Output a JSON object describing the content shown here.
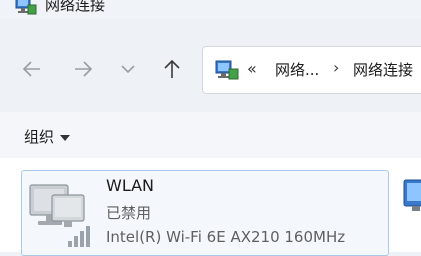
{
  "window": {
    "title": "网络连接"
  },
  "nav": {
    "back_icon": "arrow-left-icon",
    "forward_icon": "arrow-right-icon",
    "recent_icon": "chevron-down-icon",
    "up_icon": "arrow-up-icon"
  },
  "address": {
    "overflow": "«",
    "segments": [
      "网络...",
      "网络连接"
    ],
    "separator": "›"
  },
  "toolbar": {
    "organize_label": "组织"
  },
  "connections": [
    {
      "name": "WLAN",
      "status": "已禁用",
      "adapter": "Intel(R) Wi-Fi 6E AX210 160MHz"
    }
  ],
  "colors": {
    "selection_border": "#a9cbe9",
    "selection_fill": "#f4f8fd",
    "icon_gray": "#9aa3ab"
  }
}
